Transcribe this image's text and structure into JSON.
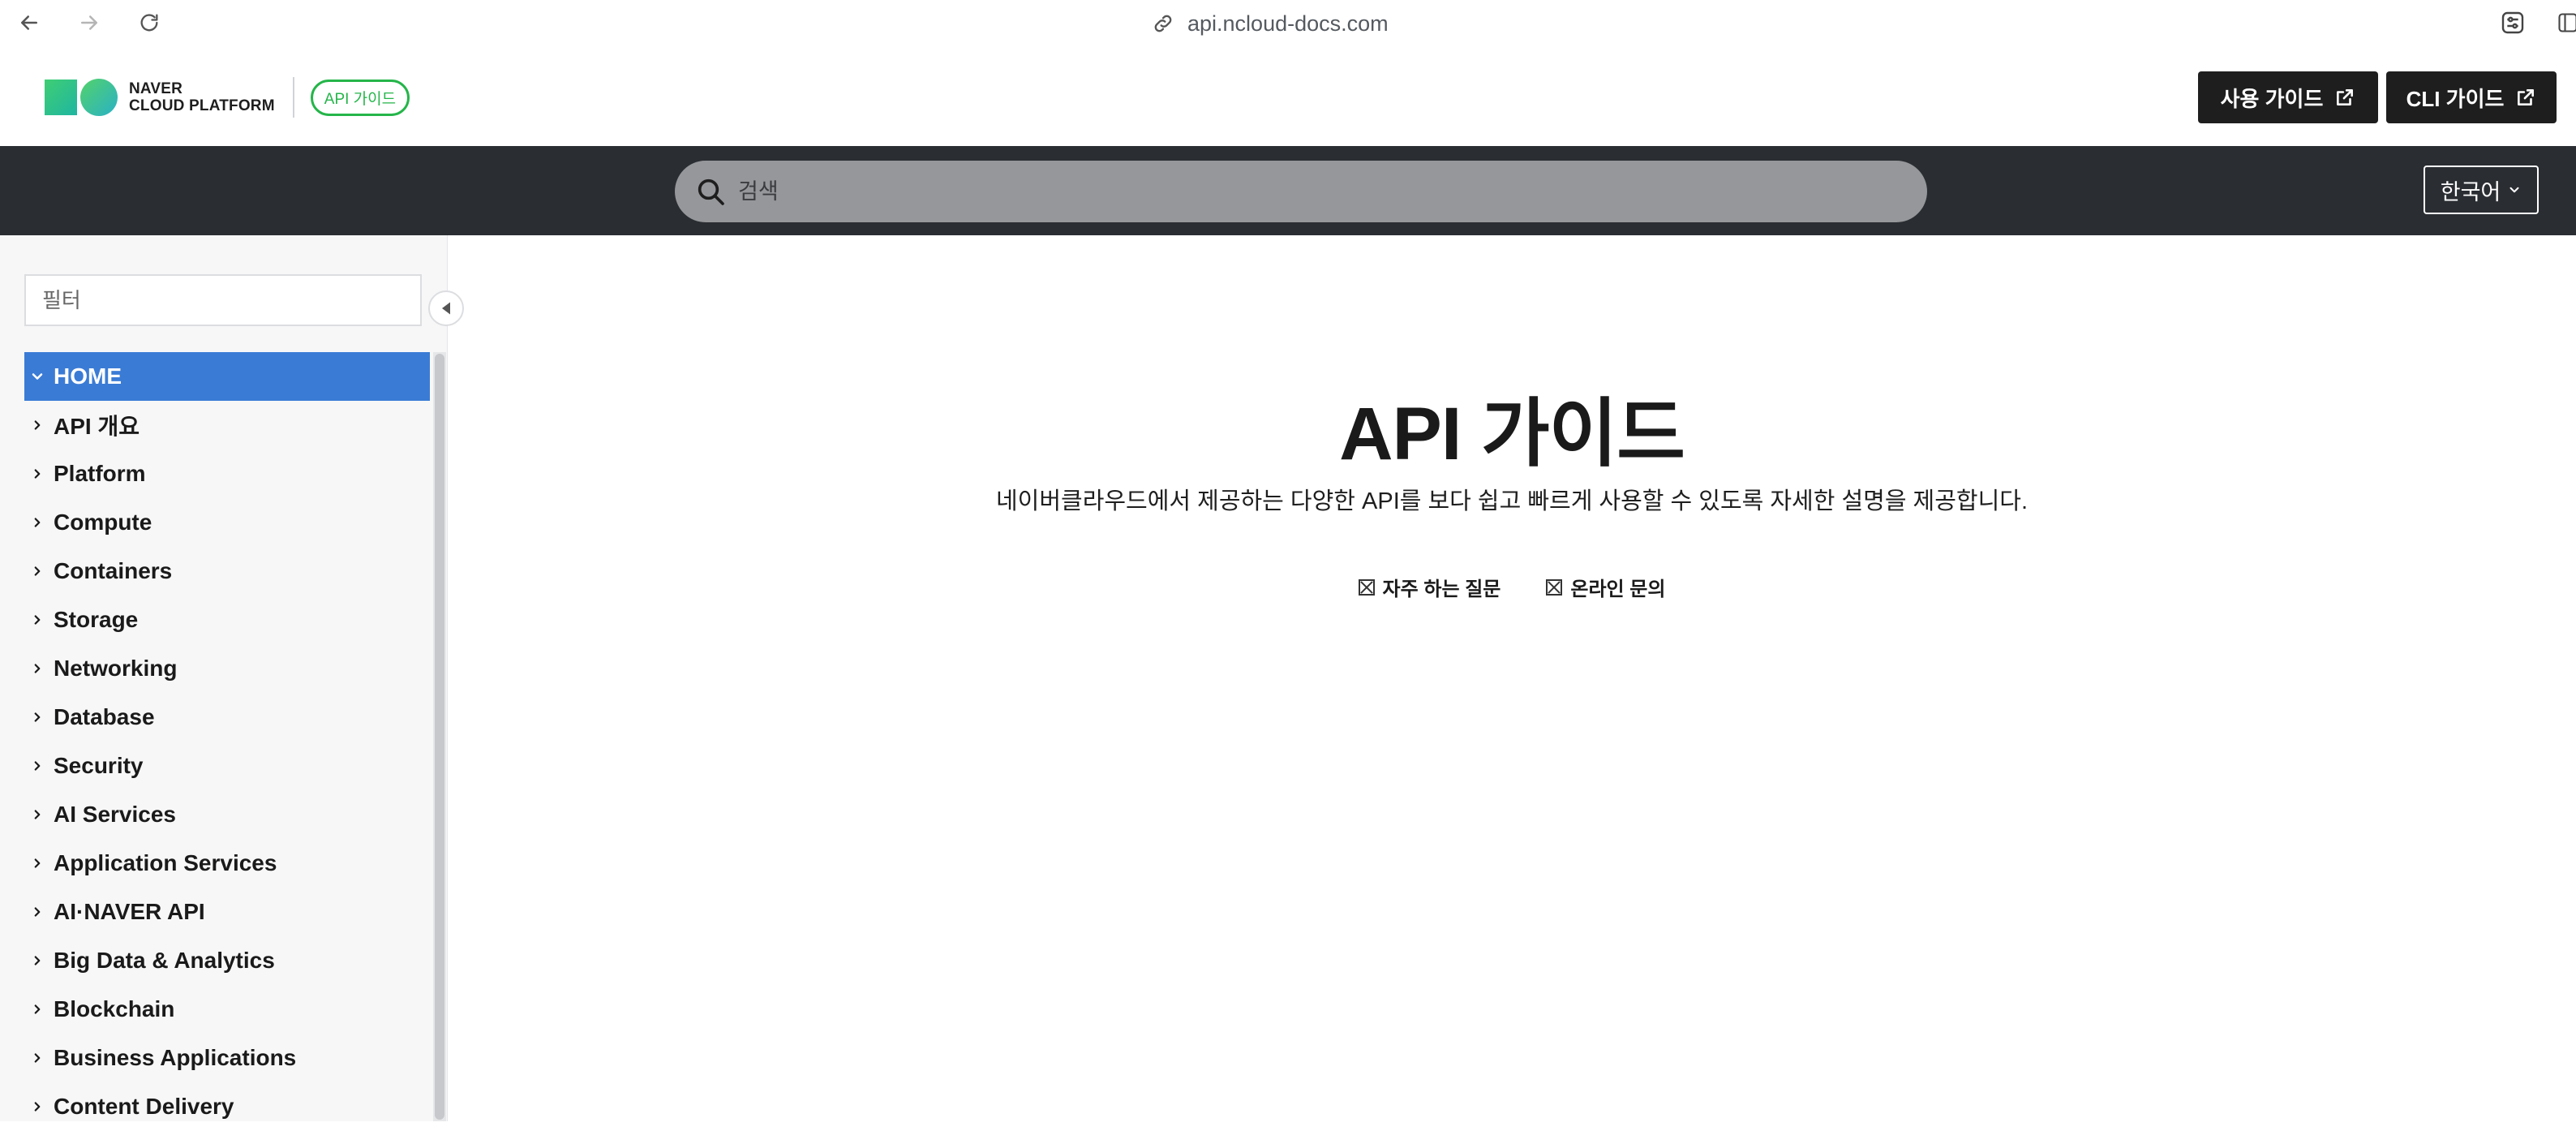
{
  "browser": {
    "url": "api.ncloud-docs.com"
  },
  "header": {
    "logo_line1": "NAVER",
    "logo_line2": "CLOUD PLATFORM",
    "badge": "API 가이드",
    "user_guide_button": "사용 가이드",
    "cli_guide_button": "CLI 가이드",
    "accent_color": "#25b54a"
  },
  "search": {
    "placeholder": "검색"
  },
  "language": {
    "selected": "한국어"
  },
  "sidebar": {
    "filter_placeholder": "필터",
    "items": [
      {
        "label": "HOME",
        "expanded": true,
        "active": true
      },
      {
        "label": "API 개요"
      },
      {
        "label": "Platform"
      },
      {
        "label": "Compute"
      },
      {
        "label": "Containers"
      },
      {
        "label": "Storage"
      },
      {
        "label": "Networking"
      },
      {
        "label": "Database"
      },
      {
        "label": "Security"
      },
      {
        "label": "AI Services"
      },
      {
        "label": "Application Services"
      },
      {
        "label": "AI·NAVER API"
      },
      {
        "label": "Big Data & Analytics"
      },
      {
        "label": "Blockchain"
      },
      {
        "label": "Business Applications"
      },
      {
        "label": "Content Delivery"
      }
    ]
  },
  "main": {
    "title": "API 가이드",
    "description": "네이버클라우드에서 제공하는 다양한 API를 보다 쉽고 빠르게 사용할 수 있도록 자세한 설명을 제공합니다.",
    "links": [
      {
        "label": "자주 하는 질문",
        "icon": "broken-image-icon"
      },
      {
        "label": "온라인 문의",
        "icon": "broken-image-icon"
      }
    ]
  }
}
